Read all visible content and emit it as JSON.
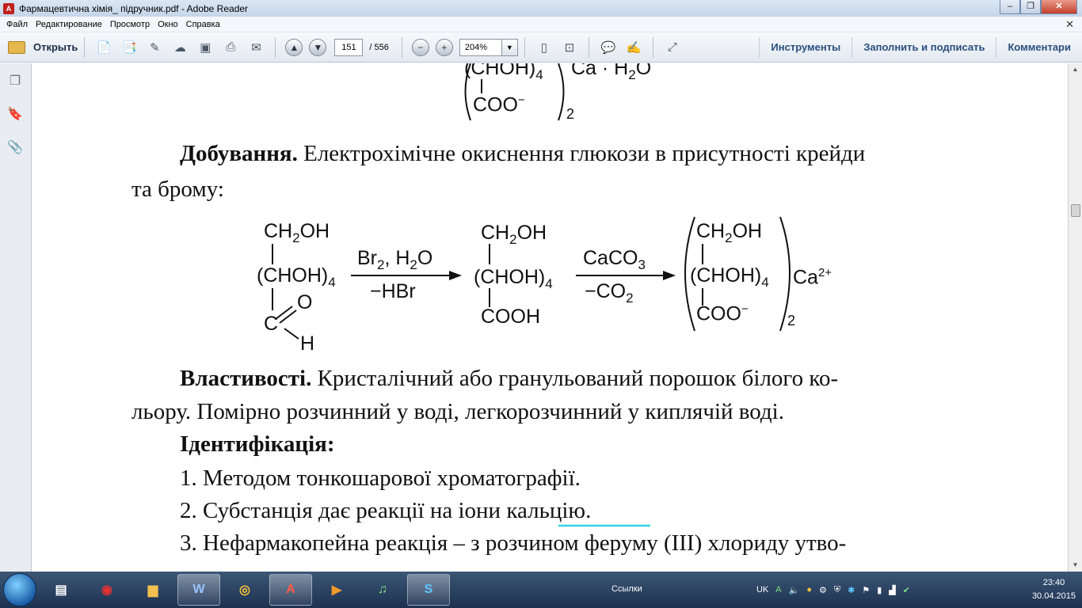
{
  "window": {
    "title": "Фармацевтична хімія_ підручник.pdf - Adobe Reader"
  },
  "menu": [
    "Файл",
    "Редактирование",
    "Просмотр",
    "Окно",
    "Справка"
  ],
  "toolbar": {
    "open_label": "Открыть",
    "page_current": "151",
    "page_total": "/ 556",
    "zoom": "204%",
    "tools_label": "Инструменты",
    "fill_sign_label": "Заполнить и подписать",
    "comments_label": "Комментари"
  },
  "document": {
    "top_fragment": {
      "line1": "(CHOH)",
      "line1_sub": "4",
      "ca_h2o": "Ca · H",
      "ca_h2o_sub": "2",
      "ca_h2o_end": "O",
      "line2": "COO",
      "line2_sup": "−",
      "bracket_sub": "2"
    },
    "production_heading": "Добування.",
    "production_text": " Електрохімічне окиснення глюкози в присутності крейди",
    "production_text2": "та  брому:",
    "reaction": {
      "r1_top": "CH",
      "r1_top_sub": "2",
      "r1_top_end": "OH",
      "r1_mid": "(CHOH)",
      "r1_mid_sub": "4",
      "r1_o": "O",
      "r1_c": "C",
      "r1_h": "H",
      "arrow1_top": "Br",
      "arrow1_top_sub": "2",
      "arrow1_top_end": ", H",
      "arrow1_top_sub2": "2",
      "arrow1_top_end2": "O",
      "arrow1_bottom": "−HBr",
      "r2_top": "CH",
      "r2_top_sub": "2",
      "r2_top_end": "OH",
      "r2_mid": "(CHOH)",
      "r2_mid_sub": "4",
      "r2_bottom": "COOH",
      "arrow2_top": "CaCO",
      "arrow2_top_sub": "3",
      "arrow2_bottom": "−CO",
      "arrow2_bottom_sub": "2",
      "p_top": "CH",
      "p_top_sub": "2",
      "p_top_end": "OH",
      "p_mid": "(CHOH)",
      "p_mid_sub": "4",
      "p_bottom": "COO",
      "p_bottom_sup": "−",
      "p_ca": "Ca",
      "p_ca_sup": "2+",
      "p_bracket_sub": "2"
    },
    "properties_heading": "Властивості.",
    "properties_text": " Кристалічний або гранульований порошок білого ко-",
    "properties_text2": "льору. Помірно розчинний у воді, легкорозчинний у киплячій воді.",
    "identification_heading": "Ідентифікація:",
    "item1": "1.  Методом тонкошарової хроматографії.",
    "item2_start": "2. Субстанція дає реакції на іони ",
    "item2_link": "кальцію",
    "item2_end": ".",
    "item3": "3. Нефармакопейна реакція – з розчином феруму (III) хлориду утво-"
  },
  "taskbar": {
    "links_label": "Ссылки",
    "lang": "UK",
    "time": "23:40",
    "date": "30.04.2015"
  },
  "colors": {
    "accent": "#2b4f7e",
    "link_underline": "#33d1e6",
    "adobe_red": "#c0201b"
  }
}
